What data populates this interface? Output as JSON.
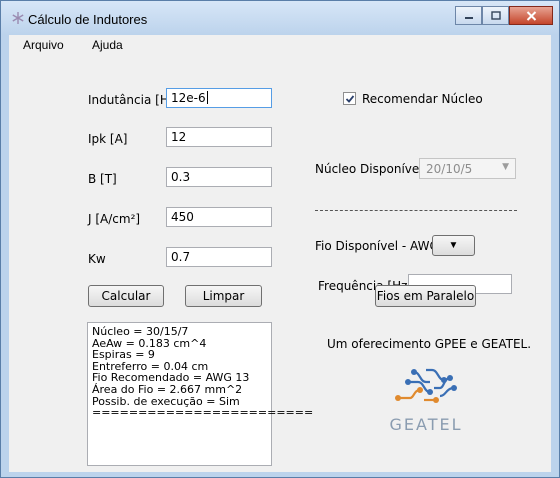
{
  "window": {
    "title": "Cálculo de Indutores",
    "app_icon": "snowflake-icon"
  },
  "caption_buttons": {
    "minimize": "minimize-icon",
    "maximize": "maximize-icon",
    "close": "close-icon"
  },
  "menu": {
    "file": "Arquivo",
    "help": "Ajuda"
  },
  "fields": {
    "inductance": {
      "label": "Indutância [H]",
      "value": "12e-6"
    },
    "ipk": {
      "label": "Ipk [A]",
      "value": "12"
    },
    "b": {
      "label": "B [T]",
      "value": "0.3"
    },
    "j": {
      "label": "J [A/cm²]",
      "value": "450"
    },
    "kw": {
      "label": "Kw",
      "value": "0.7"
    }
  },
  "buttons": {
    "calculate": "Calcular",
    "clear": "Limpar",
    "parallel": "Fios em Paralelo"
  },
  "output_lines": [
    "Núcleo = 30/15/7",
    "AeAw = 0.183 cm^4",
    "Espiras = 9",
    "Entreferro = 0.04 cm",
    "Fio Recomendado = AWG 13",
    "Área do Fio = 2.667 mm^2",
    "Possib. de execução = Sim",
    "========================"
  ],
  "right": {
    "recommend_core": {
      "label": "Recomendar Núcleo",
      "checked": true
    },
    "available_core": {
      "label": "Núcleo Disponível",
      "value": "20/10/5",
      "enabled": false
    },
    "available_wire": {
      "label": "Fio Disponível - AWG"
    },
    "frequency": {
      "label": "Frequência [Hz]",
      "value": ""
    },
    "sponsor_text": "Um oferecimento GPEE e GEATEL.",
    "logo_text": "GEATEL"
  },
  "colors": {
    "logo_text": "#8a9cb0",
    "logo_blue": "#3a6fb5",
    "logo_orange": "#e08a2e"
  }
}
